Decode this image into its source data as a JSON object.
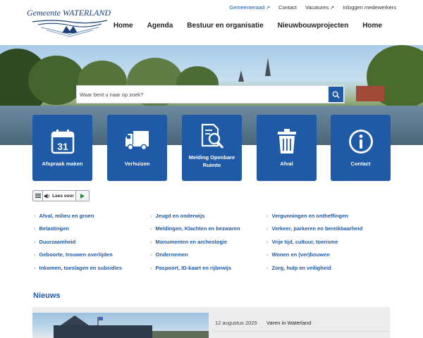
{
  "header": {
    "logo_text": "Gemeente WATERLAND",
    "top_links": [
      {
        "label": "Gemeenteraad",
        "external": true
      },
      {
        "label": "Contact",
        "external": false
      },
      {
        "label": "Vacatures",
        "external": true
      },
      {
        "label": "Inloggen medewerkers",
        "external": false
      }
    ],
    "nav": [
      "Home",
      "Agenda",
      "Bestuur en organisatie",
      "Nieuwbouwprojecten",
      "Home"
    ],
    "ext_icon": "↗"
  },
  "search": {
    "placeholder": "Waar bent u naar op zoek?",
    "button_icon": "search-icon"
  },
  "tiles": [
    {
      "label": "Afspraak maken",
      "icon": "calendar-icon",
      "icon_text": "31"
    },
    {
      "label": "Verhuizen",
      "icon": "truck-icon"
    },
    {
      "label": "Melding Openbare Ruimte",
      "icon": "document-search-icon"
    },
    {
      "label": "Afval",
      "icon": "trash-bin-icon"
    },
    {
      "label": "Contact",
      "icon": "info-icon"
    }
  ],
  "readspeaker": {
    "label": "Lees voor"
  },
  "topics": {
    "col1": [
      "Afval, milieu en groen",
      "Belastingen",
      "Duurzaamheid",
      "Geboorte, trouwen overlijden",
      "Inkomen, toeslagen en subsidies"
    ],
    "col2": [
      "Jeugd en onderwijs",
      "Meldingen, Klachten en bezwaren",
      "Monumenten en archeologie",
      "Ondernemen",
      "Paspoort, ID-kaart en rijbewijs"
    ],
    "col3": [
      "Vergunningen en ontheffingen",
      "Verkeer, parkeren en bereikbaarheid",
      "Vrije tijd, cultuur, toerisme",
      "Wonen en (ver)bouwen",
      "Zorg, hulp en veiligheid"
    ]
  },
  "news": {
    "title": "Nieuws",
    "items": [
      {
        "date": "12 augustus 2025",
        "headline": "Varen in Waterland"
      }
    ]
  },
  "colors": {
    "brand_blue": "#1f5aa6",
    "link_blue": "#1f5aa6",
    "news_bg": "#ececec"
  }
}
